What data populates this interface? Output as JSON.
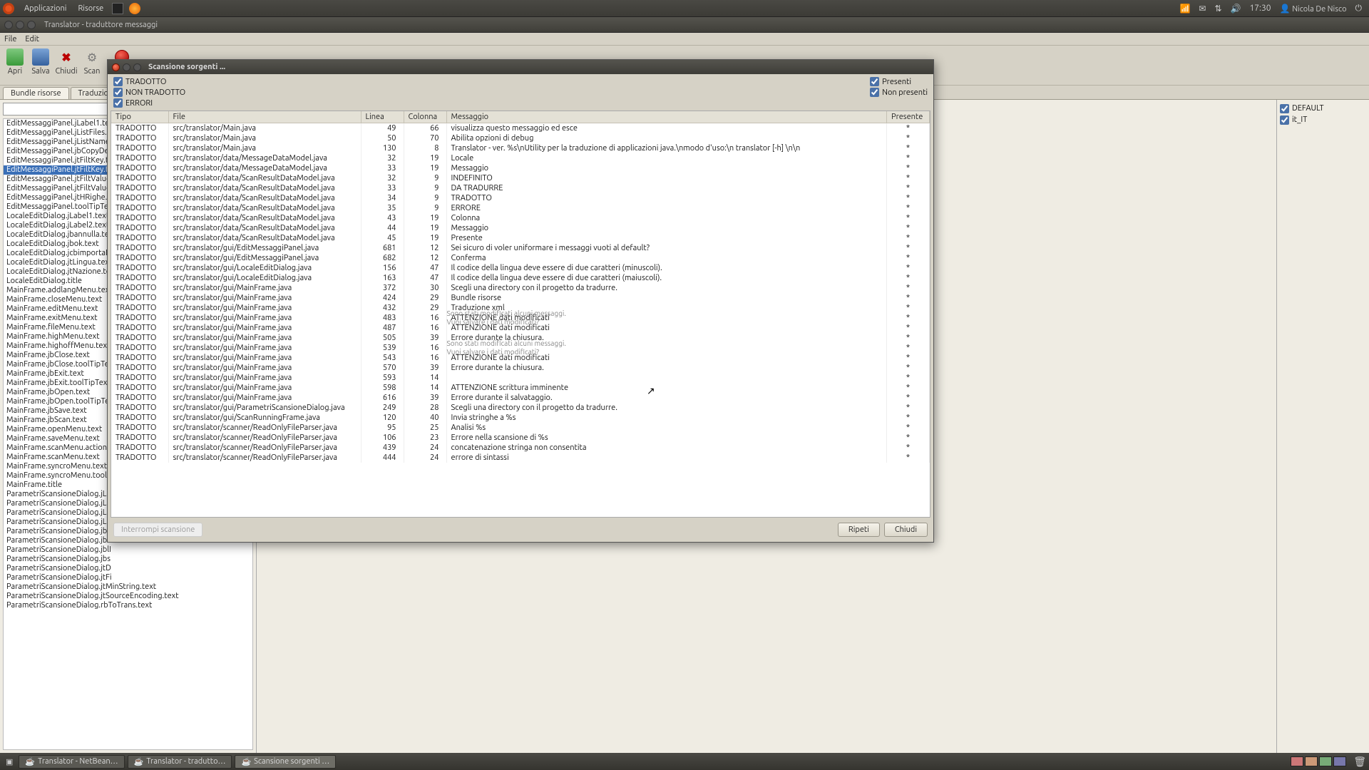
{
  "panel": {
    "apps": "Applicazioni",
    "places": "Risorse",
    "clock": "17:30",
    "user": "Nicola De Nisco"
  },
  "app": {
    "title": "Translator - traduttore messaggi",
    "menu": {
      "file": "File",
      "edit": "Edit"
    },
    "toolbar": {
      "open": "Apri",
      "save": "Salva",
      "close": "Chiudi",
      "scan": "Scan"
    },
    "tabs": {
      "bundle": "Bundle risorse",
      "traduzione": "Traduzione"
    }
  },
  "leftList": {
    "selectedIndex": 5,
    "items": [
      "EditMessaggiPanel.jLabel1.te",
      "EditMessaggiPanel.jListFiles.t",
      "EditMessaggiPanel.jListName",
      "EditMessaggiPanel.jbCopyDe",
      "EditMessaggiPanel.jtFiltKey.te",
      "EditMessaggiPanel.jtFiltKey.tc",
      "EditMessaggiPanel.jtFiltValue",
      "EditMessaggiPanel.jtFiltValue",
      "EditMessaggiPanel.jtHRighe.t",
      "EditMessaggiPanel.toolTipTex",
      "LocaleEditDialog.jLabel1.text",
      "LocaleEditDialog.jLabel2.text",
      "LocaleEditDialog.jbannulla.te",
      "LocaleEditDialog.jbok.text",
      "LocaleEditDialog.jcbimportaD",
      "LocaleEditDialog.jtLingua.tex",
      "LocaleEditDialog.jtNazione.te",
      "LocaleEditDialog.title",
      "MainFrame.addlangMenu.tex",
      "MainFrame.closeMenu.text",
      "MainFrame.editMenu.text",
      "MainFrame.exitMenu.text",
      "MainFrame.fileMenu.text",
      "MainFrame.highMenu.text",
      "MainFrame.highoffMenu.text",
      "MainFrame.jbClose.text",
      "MainFrame.jbClose.toolTipTex",
      "MainFrame.jbExit.text",
      "MainFrame.jbExit.toolTipTex",
      "MainFrame.jbOpen.text",
      "MainFrame.jbOpen.toolTipTex",
      "MainFrame.jbSave.text",
      "MainFrame.jbScan.text",
      "MainFrame.openMenu.text",
      "MainFrame.saveMenu.text",
      "MainFrame.scanMenu.action",
      "MainFrame.scanMenu.text",
      "MainFrame.syncroMenu.text",
      "MainFrame.syncroMenu.toolT",
      "MainFrame.title",
      "ParametriScansioneDialog.jLa",
      "ParametriScansioneDialog.jLa",
      "ParametriScansioneDialog.jLa",
      "ParametriScansioneDialog.jLa",
      "ParametriScansioneDialog.jbA",
      "ParametriScansioneDialog.jbI",
      "ParametriScansioneDialog.jblI",
      "ParametriScansioneDialog.jbs",
      "ParametriScansioneDialog.jtD",
      "ParametriScansioneDialog.jtFi",
      "ParametriScansioneDialog.jtMinString.text",
      "ParametriScansioneDialog.jtSourceEncoding.text",
      "ParametriScansioneDialog.rbToTrans.text"
    ]
  },
  "rightPane": {
    "default": "DEFAULT",
    "it": "it_IT"
  },
  "scanDialog": {
    "title": "Scansione sorgenti ...",
    "filters": {
      "tradotto": "TRADOTTO",
      "nontradotto": "NON TRADOTTO",
      "errori": "ERRORI",
      "presenti": "Presenti",
      "nonpresenti": "Non presenti"
    },
    "columns": {
      "tipo": "Tipo",
      "file": "File",
      "linea": "Linea",
      "colonna": "Colonna",
      "messaggio": "Messaggio",
      "presente": "Presente"
    },
    "rows": [
      {
        "t": "TRADOTTO",
        "f": "src/translator/Main.java",
        "l": 49,
        "c": 66,
        "m": "visualizza questo messaggio ed esce",
        "p": "*"
      },
      {
        "t": "TRADOTTO",
        "f": "src/translator/Main.java",
        "l": 50,
        "c": 70,
        "m": "Abilita opzioni di debug",
        "p": "*"
      },
      {
        "t": "TRADOTTO",
        "f": "src/translator/Main.java",
        "l": 130,
        "c": 8,
        "m": "Translator - ver. %s\\nUtility per la traduzione di applicazioni java.\\nmodo d'uso:\\n  translator [-h] \\n\\n",
        "p": "*"
      },
      {
        "t": "TRADOTTO",
        "f": "src/translator/data/MessageDataModel.java",
        "l": 32,
        "c": 19,
        "m": "Locale",
        "p": "*"
      },
      {
        "t": "TRADOTTO",
        "f": "src/translator/data/MessageDataModel.java",
        "l": 33,
        "c": 19,
        "m": "Messaggio",
        "p": "*"
      },
      {
        "t": "TRADOTTO",
        "f": "src/translator/data/ScanResultDataModel.java",
        "l": 32,
        "c": 9,
        "m": "INDEFINITO",
        "p": "*"
      },
      {
        "t": "TRADOTTO",
        "f": "src/translator/data/ScanResultDataModel.java",
        "l": 33,
        "c": 9,
        "m": "DA TRADURRE",
        "p": "*"
      },
      {
        "t": "TRADOTTO",
        "f": "src/translator/data/ScanResultDataModel.java",
        "l": 34,
        "c": 9,
        "m": "TRADOTTO",
        "p": "*"
      },
      {
        "t": "TRADOTTO",
        "f": "src/translator/data/ScanResultDataModel.java",
        "l": 35,
        "c": 9,
        "m": "ERRORE",
        "p": "*"
      },
      {
        "t": "TRADOTTO",
        "f": "src/translator/data/ScanResultDataModel.java",
        "l": 43,
        "c": 19,
        "m": "Colonna",
        "p": "*"
      },
      {
        "t": "TRADOTTO",
        "f": "src/translator/data/ScanResultDataModel.java",
        "l": 44,
        "c": 19,
        "m": "Messaggio",
        "p": "*"
      },
      {
        "t": "TRADOTTO",
        "f": "src/translator/data/ScanResultDataModel.java",
        "l": 45,
        "c": 19,
        "m": "Presente",
        "p": "*"
      },
      {
        "t": "TRADOTTO",
        "f": "src/translator/gui/EditMessaggiPanel.java",
        "l": 681,
        "c": 12,
        "m": "Sei sicuro di voler uniformare i messaggi vuoti al default?",
        "p": "*"
      },
      {
        "t": "TRADOTTO",
        "f": "src/translator/gui/EditMessaggiPanel.java",
        "l": 682,
        "c": 12,
        "m": "Conferma",
        "p": "*"
      },
      {
        "t": "TRADOTTO",
        "f": "src/translator/gui/LocaleEditDialog.java",
        "l": 156,
        "c": 47,
        "m": "Il codice della lingua deve essere di due caratteri (minuscoli).",
        "p": "*"
      },
      {
        "t": "TRADOTTO",
        "f": "src/translator/gui/LocaleEditDialog.java",
        "l": 163,
        "c": 47,
        "m": "Il codice della lingua deve essere di due caratteri (maiuscoli).",
        "p": "*"
      },
      {
        "t": "TRADOTTO",
        "f": "src/translator/gui/MainFrame.java",
        "l": 372,
        "c": 30,
        "m": "Scegli una directory con il progetto da tradurre.",
        "p": "*"
      },
      {
        "t": "TRADOTTO",
        "f": "src/translator/gui/MainFrame.java",
        "l": 424,
        "c": 29,
        "m": "Bundle risorse",
        "p": "*"
      },
      {
        "t": "TRADOTTO",
        "f": "src/translator/gui/MainFrame.java",
        "l": 432,
        "c": 29,
        "m": "Traduzione xml",
        "p": "*"
      },
      {
        "t": "TRADOTTO",
        "f": "src/translator/gui/MainFrame.java",
        "l": 483,
        "c": 16,
        "m": "ATTENZIONE dati modificati",
        "p": "*",
        "ghost": [
          "Sono stati modificati alcuni messaggi.",
          "Vuoi salvare i dati modificati?"
        ]
      },
      {
        "t": "TRADOTTO",
        "f": "src/translator/gui/MainFrame.java",
        "l": 487,
        "c": 16,
        "m": "ATTENZIONE dati modificati",
        "p": "*"
      },
      {
        "t": "TRADOTTO",
        "f": "src/translator/gui/MainFrame.java",
        "l": 505,
        "c": 39,
        "m": "Errore durante la chiusura.",
        "p": "*"
      },
      {
        "t": "TRADOTTO",
        "f": "src/translator/gui/MainFrame.java",
        "l": 539,
        "c": 16,
        "m": "",
        "p": "*",
        "ghost": [
          "Sono stati modificati alcuni messaggi.",
          "Vuoi salvare i dati modificati?"
        ]
      },
      {
        "t": "TRADOTTO",
        "f": "src/translator/gui/MainFrame.java",
        "l": 543,
        "c": 16,
        "m": "ATTENZIONE dati modificati",
        "p": "*"
      },
      {
        "t": "TRADOTTO",
        "f": "src/translator/gui/MainFrame.java",
        "l": 570,
        "c": 39,
        "m": "Errore durante la chiusura.",
        "p": "*"
      },
      {
        "t": "TRADOTTO",
        "f": "src/translator/gui/MainFrame.java",
        "l": 593,
        "c": 14,
        "m": "",
        "p": "*"
      },
      {
        "t": "TRADOTTO",
        "f": "src/translator/gui/MainFrame.java",
        "l": 598,
        "c": 14,
        "m": "ATTENZIONE scrittura imminente",
        "p": "*"
      },
      {
        "t": "TRADOTTO",
        "f": "src/translator/gui/MainFrame.java",
        "l": 616,
        "c": 39,
        "m": "Errore durante il salvataggio.",
        "p": "*"
      },
      {
        "t": "TRADOTTO",
        "f": "src/translator/gui/ParametriScansioneDialog.java",
        "l": 249,
        "c": 28,
        "m": "Scegli una directory con il progetto da tradurre.",
        "p": "*"
      },
      {
        "t": "TRADOTTO",
        "f": "src/translator/gui/ScanRunningFrame.java",
        "l": 120,
        "c": 40,
        "m": "Invia stringhe a %s",
        "p": "*"
      },
      {
        "t": "TRADOTTO",
        "f": "src/translator/scanner/ReadOnlyFileParser.java",
        "l": 95,
        "c": 25,
        "m": "Analisi %s",
        "p": "*"
      },
      {
        "t": "TRADOTTO",
        "f": "src/translator/scanner/ReadOnlyFileParser.java",
        "l": 106,
        "c": 23,
        "m": "Errore nella scansione di %s",
        "p": "*"
      },
      {
        "t": "TRADOTTO",
        "f": "src/translator/scanner/ReadOnlyFileParser.java",
        "l": 439,
        "c": 24,
        "m": "concatenazione stringa non consentita",
        "p": "*"
      },
      {
        "t": "TRADOTTO",
        "f": "src/translator/scanner/ReadOnlyFileParser.java",
        "l": 444,
        "c": 24,
        "m": "errore di sintassi",
        "p": "*"
      }
    ],
    "footer": {
      "interrupt": "Interrompi scansione",
      "repeat": "Ripeti",
      "close": "Chiudi"
    }
  },
  "taskbar": {
    "tasks": [
      "Translator - NetBean…",
      "Translator - tradutto…",
      "Scansione sorgenti …"
    ]
  }
}
